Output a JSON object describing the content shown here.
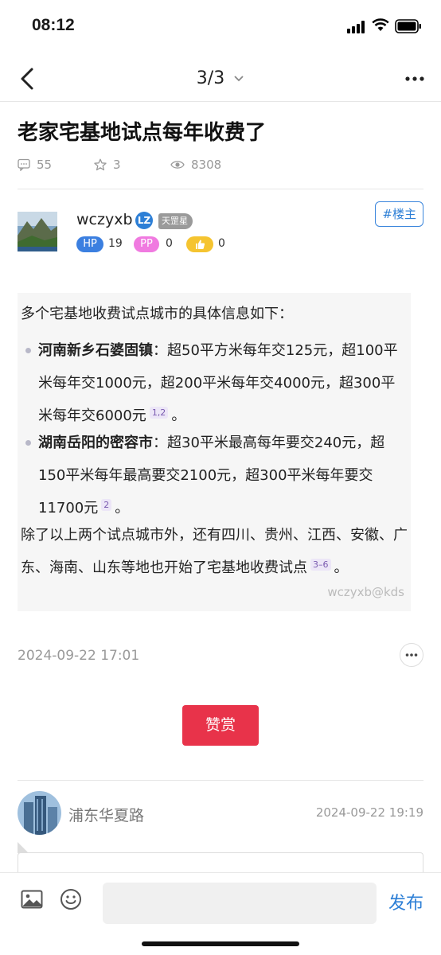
{
  "status": {
    "time": "08:12"
  },
  "nav": {
    "pager": "3/3"
  },
  "post": {
    "title": "老家宅基地试点每年收费了",
    "comments": "55",
    "stars": "3",
    "views": "8308",
    "author": "wczyxb",
    "author_badge": "LZ",
    "rank": "天罡星",
    "lou_tag": "#楼主",
    "hp_label": "HP",
    "hp_value": "19",
    "pp_label": "PP",
    "pp_value": "0",
    "like_value": "0",
    "intro": "多个宅基地收费试点城市的具体信息如下：",
    "item1_title": "河南新乡石婆固镇",
    "item1_body": "：超50平方米每年交125元，超100平米每年交1000元，超200平米每年交4000元，超300平米每年交6000元",
    "item1_ref": "1,2",
    "item2_title": "湖南岳阳的密容市",
    "item2_body": "：超30平米最高每年要交240元，超150平米每年最高要交2100元，超300平米每年要交11700元",
    "item2_ref": "2",
    "outro": "除了以上两个试点城市外，还有四川、贵州、江西、安徽、广东、海南、山东等地也开始了宅基地收费试点",
    "outro_ref": "3–6",
    "period": "。",
    "watermark": "wczyxb@kds",
    "date": "2024-09-22 17:01",
    "reward": "赞赏"
  },
  "reply": {
    "user": "浦东华夏路",
    "date": "2024-09-22 19:19"
  },
  "bottom": {
    "send": "发布",
    "input_placeholder": ""
  }
}
